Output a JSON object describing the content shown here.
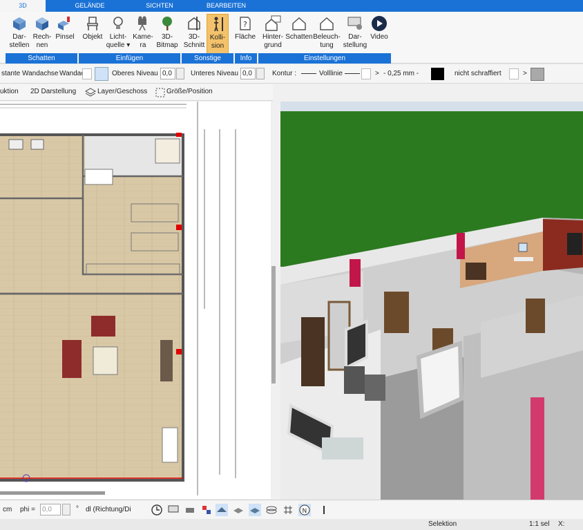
{
  "tabs": [
    {
      "label": "3D",
      "active": true
    },
    {
      "label": "GELÄNDE"
    },
    {
      "label": "SICHTEN"
    },
    {
      "label": "BEARBEITEN"
    }
  ],
  "ribbon": {
    "buttons": [
      {
        "label1": "Dar-",
        "label2": "stellen",
        "icon": "cube-icon"
      },
      {
        "label1": "Rech-",
        "label2": "nen",
        "icon": "cube-shade-icon"
      },
      {
        "label1": "Pinsel",
        "label2": "",
        "icon": "brush-cube-icon"
      },
      {
        "label1": "Objekt",
        "label2": "",
        "icon": "chair-icon"
      },
      {
        "label1": "Licht-",
        "label2": "quelle ▾",
        "icon": "bulb-icon"
      },
      {
        "label1": "Kame-",
        "label2": "ra",
        "icon": "camera-icon"
      },
      {
        "label1": "3D-",
        "label2": "Bitmap",
        "icon": "tree-icon"
      },
      {
        "label1": "3D-",
        "label2": "Schnitt",
        "icon": "section-icon"
      },
      {
        "label1": "Kolli-",
        "label2": "sion",
        "icon": "person-icon",
        "selected": true
      },
      {
        "label1": "Fläche",
        "label2": "",
        "icon": "area-icon"
      },
      {
        "label1": "Hinter-",
        "label2": "grund",
        "icon": "house-bg-icon"
      },
      {
        "label1": "Schatten",
        "label2": "",
        "icon": "house-shadow-icon"
      },
      {
        "label1": "Beleuch-",
        "label2": "tung",
        "icon": "house-light-icon"
      },
      {
        "label1": "Dar-",
        "label2": "stellung",
        "icon": "monitor-gear-icon"
      },
      {
        "label1": "Video",
        "label2": "",
        "icon": "play-icon"
      }
    ],
    "groups": [
      "Schatten",
      "Einfügen",
      "Sonstige",
      "Info",
      "Einstellungen"
    ]
  },
  "props": {
    "wall_axis_label": "stante Wandachse",
    "wall_axis_value": "Wandac",
    "upper_label": "Oberes Niveau",
    "upper_value": "0,0",
    "lower_label": "Unteres Niveau",
    "lower_value": "0,0",
    "contour_label": "Kontur :",
    "line_label": "Volllinie",
    "thickness": "- 0,25 mm -",
    "gt1": ">",
    "gt2": ">",
    "hatch_label": "nicht schraffiert",
    "fill_color": "#000000",
    "hatch_color": "#a9a9a9"
  },
  "toolbar2": {
    "construction": "uktion",
    "view2d": "2D Darstellung",
    "layer": "Layer/Geschoss",
    "size": "Größe/Position"
  },
  "bottom": {
    "unit": "cm",
    "phi_label": "phi =",
    "phi_value": "0,0",
    "degree": "°",
    "dl": "dl (Richtung/Di"
  },
  "status": {
    "mode": "Selektion",
    "scale": "1:1 sel",
    "x_label": "X:"
  },
  "colors": {
    "accent": "#1b72d6",
    "selected": "#f3c26a",
    "floor": "#d8c7a5",
    "grass": "#2f7d1e",
    "red_marker": "#e00000"
  }
}
